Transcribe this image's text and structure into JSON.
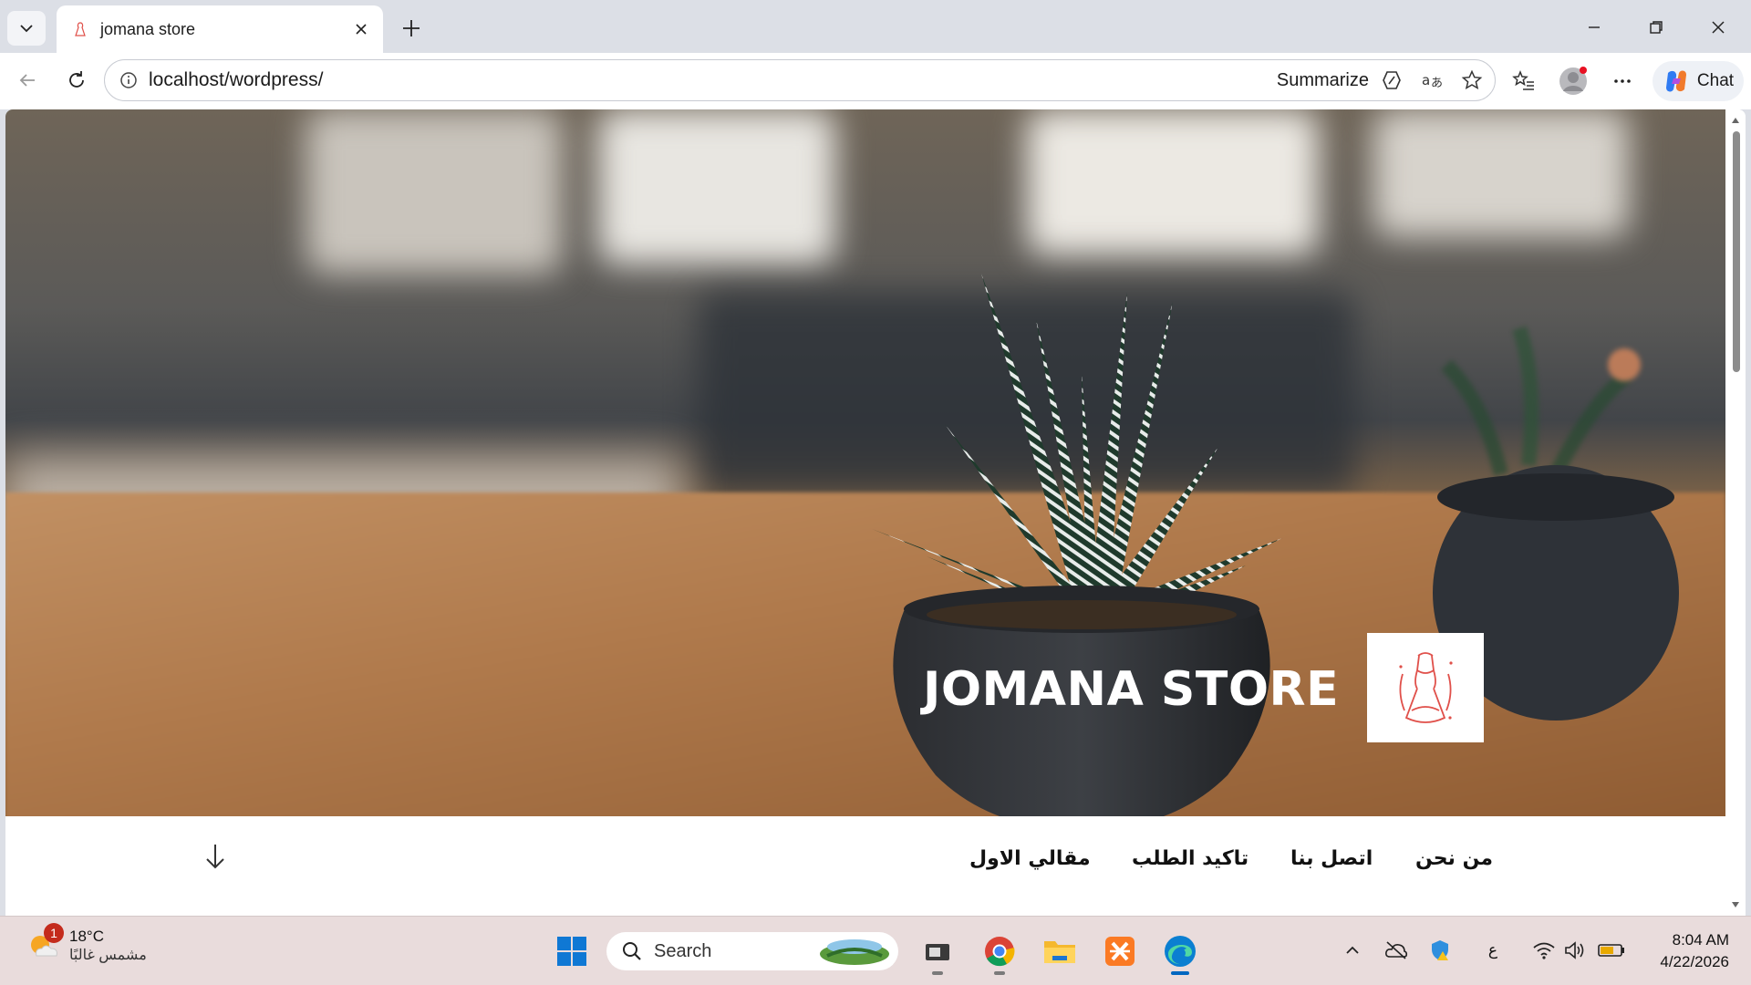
{
  "browser": {
    "tab_title": "jomana store",
    "url": "localhost/wordpress/",
    "summarize_label": "Summarize",
    "chat_label": "Chat"
  },
  "site": {
    "title": "JOMANA STORE",
    "menu": [
      "من نحن",
      "اتصل بنا",
      "تاكيد الطلب",
      "مقالي الاول"
    ]
  },
  "taskbar": {
    "weather_temp": "18°C",
    "weather_desc": "مشمس غالبًا",
    "weather_badge": "1",
    "search_placeholder": "Search",
    "lang_indicator": "ع",
    "time": "8:04 AM",
    "date": "4/22/2026"
  },
  "colors": {
    "accent": "#0067c0",
    "logo_red": "#e0504a",
    "taskbar_bg": "#e9dcdc"
  }
}
